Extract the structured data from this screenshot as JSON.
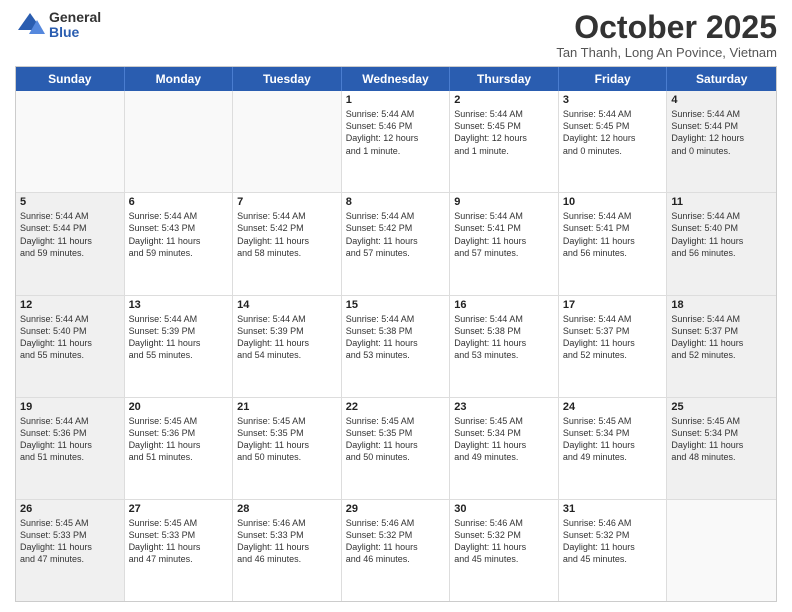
{
  "logo": {
    "general": "General",
    "blue": "Blue"
  },
  "header": {
    "month": "October 2025",
    "location": "Tan Thanh, Long An Povince, Vietnam"
  },
  "days": [
    "Sunday",
    "Monday",
    "Tuesday",
    "Wednesday",
    "Thursday",
    "Friday",
    "Saturday"
  ],
  "weeks": [
    [
      {
        "day": "",
        "info": ""
      },
      {
        "day": "",
        "info": ""
      },
      {
        "day": "",
        "info": ""
      },
      {
        "day": "1",
        "info": "Sunrise: 5:44 AM\nSunset: 5:46 PM\nDaylight: 12 hours\nand 1 minute."
      },
      {
        "day": "2",
        "info": "Sunrise: 5:44 AM\nSunset: 5:45 PM\nDaylight: 12 hours\nand 1 minute."
      },
      {
        "day": "3",
        "info": "Sunrise: 5:44 AM\nSunset: 5:45 PM\nDaylight: 12 hours\nand 0 minutes."
      },
      {
        "day": "4",
        "info": "Sunrise: 5:44 AM\nSunset: 5:44 PM\nDaylight: 12 hours\nand 0 minutes."
      }
    ],
    [
      {
        "day": "5",
        "info": "Sunrise: 5:44 AM\nSunset: 5:44 PM\nDaylight: 11 hours\nand 59 minutes."
      },
      {
        "day": "6",
        "info": "Sunrise: 5:44 AM\nSunset: 5:43 PM\nDaylight: 11 hours\nand 59 minutes."
      },
      {
        "day": "7",
        "info": "Sunrise: 5:44 AM\nSunset: 5:42 PM\nDaylight: 11 hours\nand 58 minutes."
      },
      {
        "day": "8",
        "info": "Sunrise: 5:44 AM\nSunset: 5:42 PM\nDaylight: 11 hours\nand 57 minutes."
      },
      {
        "day": "9",
        "info": "Sunrise: 5:44 AM\nSunset: 5:41 PM\nDaylight: 11 hours\nand 57 minutes."
      },
      {
        "day": "10",
        "info": "Sunrise: 5:44 AM\nSunset: 5:41 PM\nDaylight: 11 hours\nand 56 minutes."
      },
      {
        "day": "11",
        "info": "Sunrise: 5:44 AM\nSunset: 5:40 PM\nDaylight: 11 hours\nand 56 minutes."
      }
    ],
    [
      {
        "day": "12",
        "info": "Sunrise: 5:44 AM\nSunset: 5:40 PM\nDaylight: 11 hours\nand 55 minutes."
      },
      {
        "day": "13",
        "info": "Sunrise: 5:44 AM\nSunset: 5:39 PM\nDaylight: 11 hours\nand 55 minutes."
      },
      {
        "day": "14",
        "info": "Sunrise: 5:44 AM\nSunset: 5:39 PM\nDaylight: 11 hours\nand 54 minutes."
      },
      {
        "day": "15",
        "info": "Sunrise: 5:44 AM\nSunset: 5:38 PM\nDaylight: 11 hours\nand 53 minutes."
      },
      {
        "day": "16",
        "info": "Sunrise: 5:44 AM\nSunset: 5:38 PM\nDaylight: 11 hours\nand 53 minutes."
      },
      {
        "day": "17",
        "info": "Sunrise: 5:44 AM\nSunset: 5:37 PM\nDaylight: 11 hours\nand 52 minutes."
      },
      {
        "day": "18",
        "info": "Sunrise: 5:44 AM\nSunset: 5:37 PM\nDaylight: 11 hours\nand 52 minutes."
      }
    ],
    [
      {
        "day": "19",
        "info": "Sunrise: 5:44 AM\nSunset: 5:36 PM\nDaylight: 11 hours\nand 51 minutes."
      },
      {
        "day": "20",
        "info": "Sunrise: 5:45 AM\nSunset: 5:36 PM\nDaylight: 11 hours\nand 51 minutes."
      },
      {
        "day": "21",
        "info": "Sunrise: 5:45 AM\nSunset: 5:35 PM\nDaylight: 11 hours\nand 50 minutes."
      },
      {
        "day": "22",
        "info": "Sunrise: 5:45 AM\nSunset: 5:35 PM\nDaylight: 11 hours\nand 50 minutes."
      },
      {
        "day": "23",
        "info": "Sunrise: 5:45 AM\nSunset: 5:34 PM\nDaylight: 11 hours\nand 49 minutes."
      },
      {
        "day": "24",
        "info": "Sunrise: 5:45 AM\nSunset: 5:34 PM\nDaylight: 11 hours\nand 49 minutes."
      },
      {
        "day": "25",
        "info": "Sunrise: 5:45 AM\nSunset: 5:34 PM\nDaylight: 11 hours\nand 48 minutes."
      }
    ],
    [
      {
        "day": "26",
        "info": "Sunrise: 5:45 AM\nSunset: 5:33 PM\nDaylight: 11 hours\nand 47 minutes."
      },
      {
        "day": "27",
        "info": "Sunrise: 5:45 AM\nSunset: 5:33 PM\nDaylight: 11 hours\nand 47 minutes."
      },
      {
        "day": "28",
        "info": "Sunrise: 5:46 AM\nSunset: 5:33 PM\nDaylight: 11 hours\nand 46 minutes."
      },
      {
        "day": "29",
        "info": "Sunrise: 5:46 AM\nSunset: 5:32 PM\nDaylight: 11 hours\nand 46 minutes."
      },
      {
        "day": "30",
        "info": "Sunrise: 5:46 AM\nSunset: 5:32 PM\nDaylight: 11 hours\nand 45 minutes."
      },
      {
        "day": "31",
        "info": "Sunrise: 5:46 AM\nSunset: 5:32 PM\nDaylight: 11 hours\nand 45 minutes."
      },
      {
        "day": "",
        "info": ""
      }
    ]
  ]
}
